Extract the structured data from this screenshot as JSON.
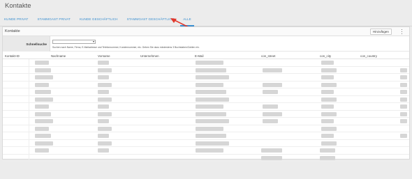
{
  "page": {
    "title": "Kontakte"
  },
  "tabs": [
    {
      "label": "KUNDE PRIVAT",
      "active": false
    },
    {
      "label": "STAMMGAST PRIVAT",
      "active": false
    },
    {
      "label": "KUNDE GESCHÄFTLICH",
      "active": false
    },
    {
      "label": "STAMMGAST GESCHÄFTLICH",
      "active": false
    },
    {
      "label": "ALLE",
      "active": true
    }
  ],
  "card": {
    "title": "Kontakte",
    "add_button": "Hinzufügen",
    "more_icon": "vertical-ellipsis-icon"
  },
  "search": {
    "label": "Schnellsuche",
    "value": "",
    "hint": "Suchen nach Name, Firma, E-Mailadresse und Telefonnummer, Kundennummer, etc. Geben Sie dazu mindestens 3 Buchstaben/Zahlen ein."
  },
  "table": {
    "columns": [
      "Kontakt-ID",
      "Nachname",
      "Vorname",
      "Unternehmen",
      "E-Mail",
      "con_street",
      "con_city",
      "con_country"
    ],
    "row_count": 14
  },
  "colors": {
    "accent": "#3b8fd0",
    "annotation_arrow": "#e2362a"
  }
}
